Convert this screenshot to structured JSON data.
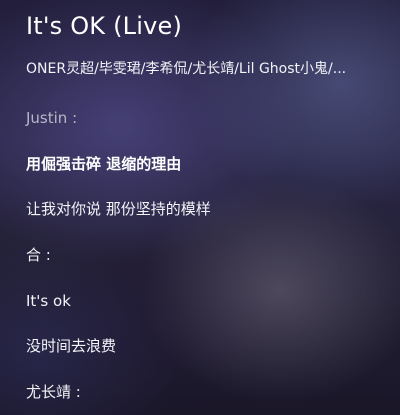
{
  "song": {
    "title": "It's OK (Live)",
    "artists": "ONER灵超/毕雯珺/李希侃/尤长靖/Lil Ghost小鬼/..."
  },
  "lyrics": [
    {
      "text": "Justin :",
      "style": "dim"
    },
    {
      "text": "用倔强击碎 退缩的理由",
      "style": "current"
    },
    {
      "text": "让我对你说 那份坚持的模样",
      "style": "normal"
    },
    {
      "text": "合 :",
      "style": "normal"
    },
    {
      "text": "It's ok",
      "style": "normal"
    },
    {
      "text": "没时间去浪费",
      "style": "normal"
    },
    {
      "text": "尤长靖 :",
      "style": "normal"
    }
  ]
}
